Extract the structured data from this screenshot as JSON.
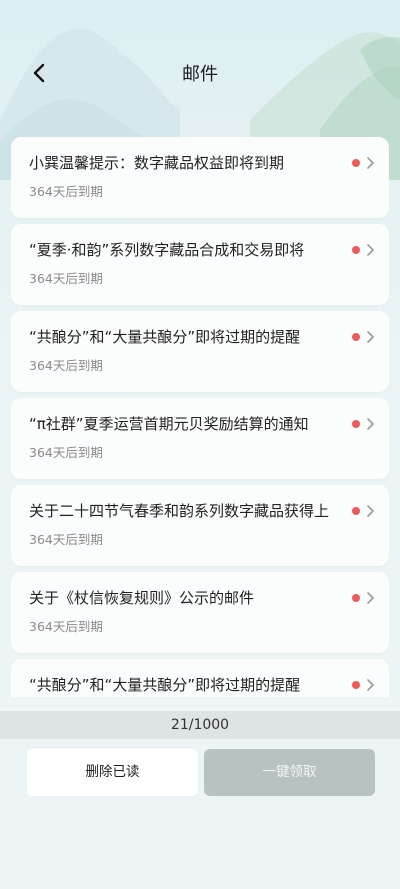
{
  "header": {
    "title": "邮件",
    "back_icon": "chevron-left-icon"
  },
  "mails": [
    {
      "title": "小巽温馨提示：数字藏品权益即将到期",
      "expiry": "364天后到期",
      "unread": true
    },
    {
      "title": "“夏季·和韵”系列数字藏品合成和交易即将",
      "expiry": "364天后到期",
      "unread": true
    },
    {
      "title": "“共酿分”和“大量共酿分”即将过期的提醒",
      "expiry": "364天后到期",
      "unread": true
    },
    {
      "title": "“π社群”夏季运营首期元贝奖励结算的通知",
      "expiry": "364天后到期",
      "unread": true
    },
    {
      "title": "关于二十四节气春季和韵系列数字藏品获得上",
      "expiry": "364天后到期",
      "unread": true
    },
    {
      "title": "关于《杖信恢复规则》公示的邮件",
      "expiry": "364天后到期",
      "unread": true
    },
    {
      "title": "“共酿分”和“大量共酿分”即将过期的提醒",
      "expiry": "",
      "unread": true
    }
  ],
  "footer": {
    "count": "21/1000",
    "delete_read_label": "删除已读",
    "claim_all_label": "一键领取"
  },
  "colors": {
    "unread_dot": "#e85c5c",
    "claim_disabled": "#b8c2c1",
    "count_bar": "#dde4e6"
  }
}
